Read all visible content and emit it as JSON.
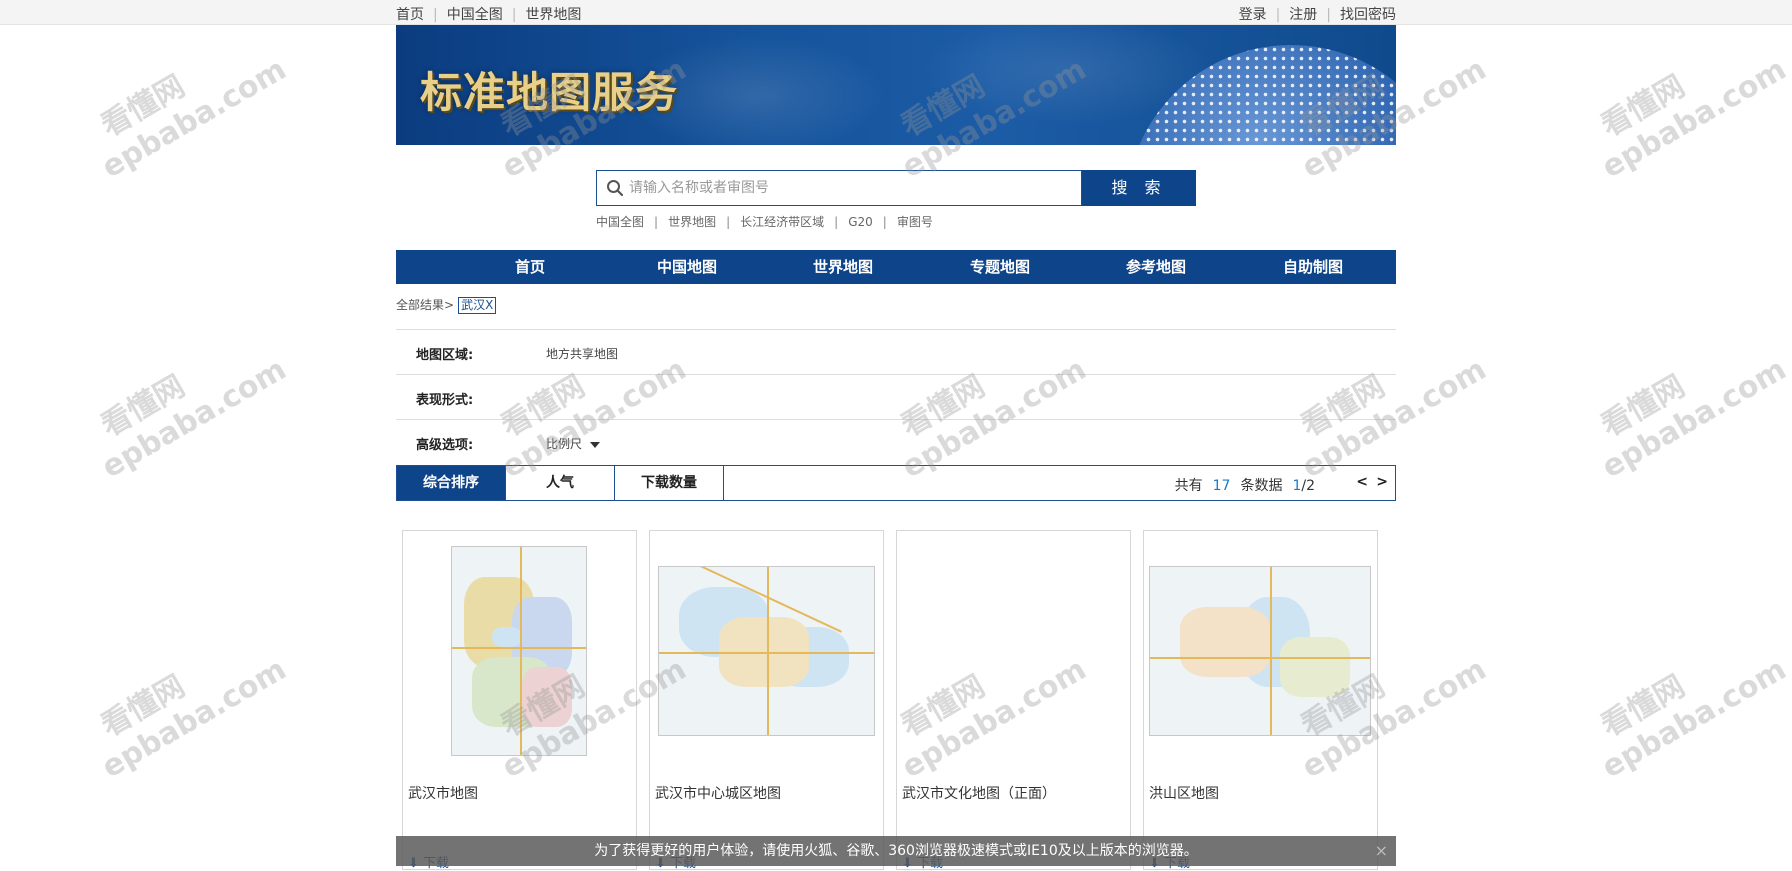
{
  "topbar": {
    "left": [
      "首页",
      "中国全图",
      "世界地图"
    ],
    "right": [
      "登录",
      "注册",
      "找回密码"
    ]
  },
  "banner": {
    "title": "标准地图服务"
  },
  "search": {
    "placeholder": "请输入名称或者审图号",
    "button": "搜 索"
  },
  "quick_links": [
    "中国全图",
    "世界地图",
    "长江经济带区域",
    "G20",
    "审图号"
  ],
  "nav": [
    "首页",
    "中国地图",
    "世界地图",
    "专题地图",
    "参考地图",
    "自助制图"
  ],
  "breadcrumb": {
    "prefix": "全部结果>",
    "tag": "武汉X"
  },
  "filters": [
    {
      "label": "地图区域:",
      "value": "地方共享地图"
    },
    {
      "label": "表现形式:",
      "value": ""
    },
    {
      "label": "高级选项:",
      "value": "比例尺"
    }
  ],
  "sort": {
    "tabs": [
      "综合排序",
      "人气",
      "下载数量"
    ],
    "total_prefix": "共有",
    "total": "17",
    "total_suffix": "条数据",
    "page_current": "1",
    "page_total": "/2",
    "prev": "<",
    "next": ">"
  },
  "cards": [
    {
      "title": "武汉市地图",
      "download": "下载"
    },
    {
      "title": "武汉市中心城区地图",
      "download": "下载"
    },
    {
      "title": "武汉市文化地图（正面）",
      "download": "下载"
    },
    {
      "title": "洪山区地图",
      "download": "下载"
    }
  ],
  "notice": {
    "text": "为了获得更好的用户体验，请使用火狐、谷歌、360浏览器极速模式或IE10及以上版本的浏览器。",
    "close": "×"
  },
  "watermark": {
    "cn": "看懂网",
    "en": "epbaba.com"
  },
  "colors": {
    "primary": "#0e4489",
    "accent": "#1a7ac9"
  },
  "icons": {
    "search": "search-icon",
    "caret": "caret-down-icon",
    "download": "download-icon",
    "close": "close-icon"
  }
}
